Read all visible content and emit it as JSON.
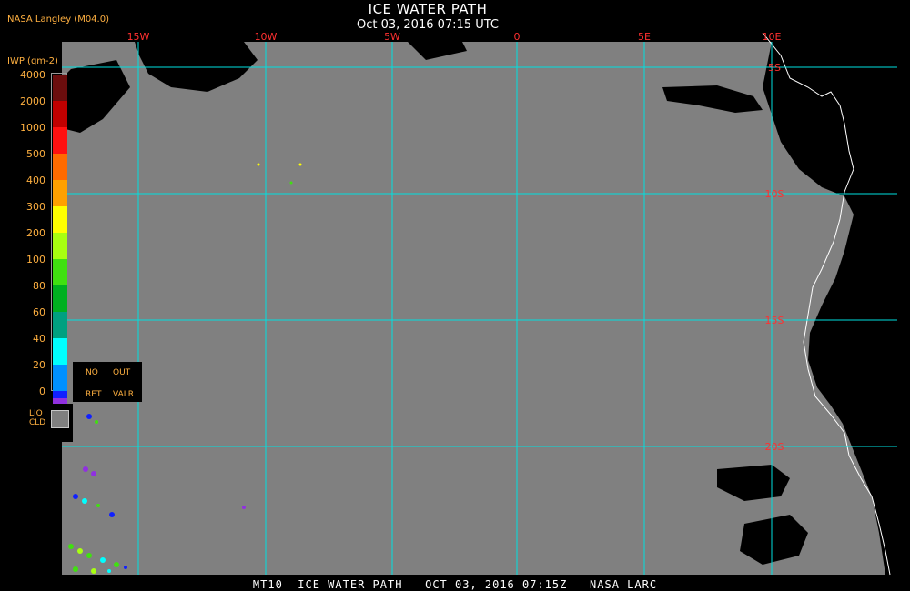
{
  "header": {
    "title": "ICE WATER PATH",
    "subtitle": "Oct 03, 2016 07:15 UTC",
    "producer": "NASA Langley (M04.0)"
  },
  "footer": {
    "text": "MT10  ICE WATER PATH   OCT 03, 2016 07:15Z   NASA LARC"
  },
  "legend": {
    "title": "IWP (gm-2)",
    "levels": [
      {
        "label": "4000",
        "color": "#6b0d0d"
      },
      {
        "label": "2000",
        "color": "#c00000"
      },
      {
        "label": "1000",
        "color": "#ff1010"
      },
      {
        "label": "500",
        "color": "#ff6a00"
      },
      {
        "label": "400",
        "color": "#ffa000"
      },
      {
        "label": "300",
        "color": "#ffff00"
      },
      {
        "label": "200",
        "color": "#a8ff10"
      },
      {
        "label": "100",
        "color": "#40e010"
      },
      {
        "label": "80",
        "color": "#00b020"
      },
      {
        "label": "60",
        "color": "#00a080"
      },
      {
        "label": "40",
        "color": "#00ffff"
      },
      {
        "label": "20",
        "color": "#0090ff"
      },
      {
        "label": "0",
        "color": "#1020ff"
      }
    ],
    "bottom_swatch_color": "#9030e0",
    "status": {
      "no": "NO",
      "out": "OUT",
      "ret": "RET",
      "valr": "VALR"
    },
    "liq": {
      "label": "LIQ\nCLD",
      "color": "#808080"
    }
  },
  "map": {
    "background_color": "#808080",
    "grid_color": "#00e0e0",
    "grid_label_color": "#ff3030",
    "longitudes": [
      {
        "label": "15W"
      },
      {
        "label": "10W"
      },
      {
        "label": "5W"
      },
      {
        "label": "0"
      },
      {
        "label": "5E"
      },
      {
        "label": "10E"
      }
    ],
    "latitudes": [
      {
        "label": "5S"
      },
      {
        "label": "10S"
      },
      {
        "label": "15S"
      },
      {
        "label": "20S"
      }
    ]
  }
}
